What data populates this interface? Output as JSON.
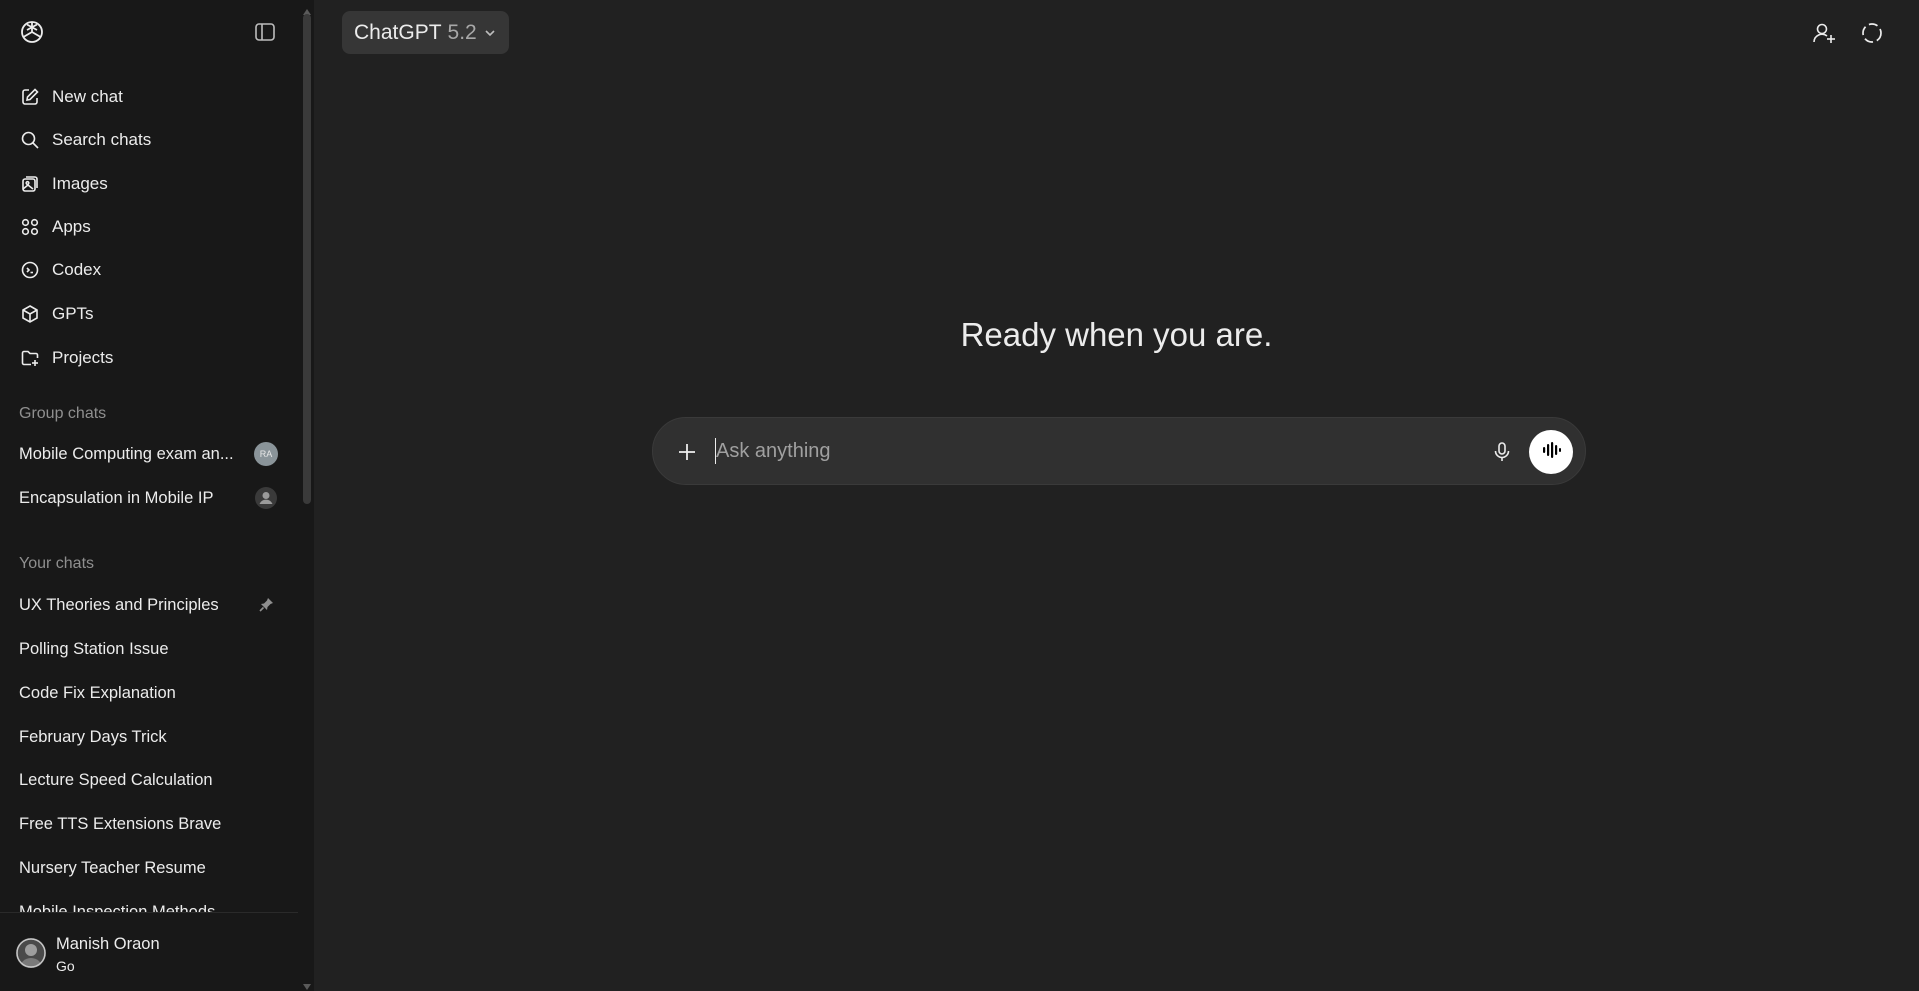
{
  "sidebar": {
    "nav": [
      {
        "label": "New chat",
        "icon": "new-chat-icon"
      },
      {
        "label": "Search chats",
        "icon": "search-icon"
      },
      {
        "label": "Images",
        "icon": "images-icon"
      },
      {
        "label": "Apps",
        "icon": "apps-icon"
      },
      {
        "label": "Codex",
        "icon": "codex-icon"
      },
      {
        "label": "GPTs",
        "icon": "gpts-icon"
      },
      {
        "label": "Projects",
        "icon": "projects-icon"
      }
    ],
    "group_chats_title": "Group chats",
    "group_chats": [
      {
        "label": "Mobile Computing exam an...",
        "badge": "RA"
      },
      {
        "label": "Encapsulation in Mobile IP"
      }
    ],
    "your_chats_title": "Your chats",
    "chats": [
      {
        "label": "UX Theories and Principles",
        "pinned": true
      },
      {
        "label": "Polling Station Issue"
      },
      {
        "label": "Code Fix Explanation"
      },
      {
        "label": "February Days Trick"
      },
      {
        "label": "Lecture Speed Calculation"
      },
      {
        "label": "Free TTS Extensions Brave"
      },
      {
        "label": "Nursery Teacher Resume"
      },
      {
        "label": "Mobile Inspection Methods"
      }
    ],
    "user": {
      "name": "Manish Oraon",
      "plan": "Go"
    }
  },
  "header": {
    "model_name": "ChatGPT",
    "model_version": "5.2"
  },
  "main": {
    "hero": "Ready when you are.",
    "composer_placeholder": "Ask anything"
  },
  "colors": {
    "background": "#212121",
    "sidebar": "#181818",
    "composer": "#303030",
    "voice_button": "#ffffff"
  }
}
